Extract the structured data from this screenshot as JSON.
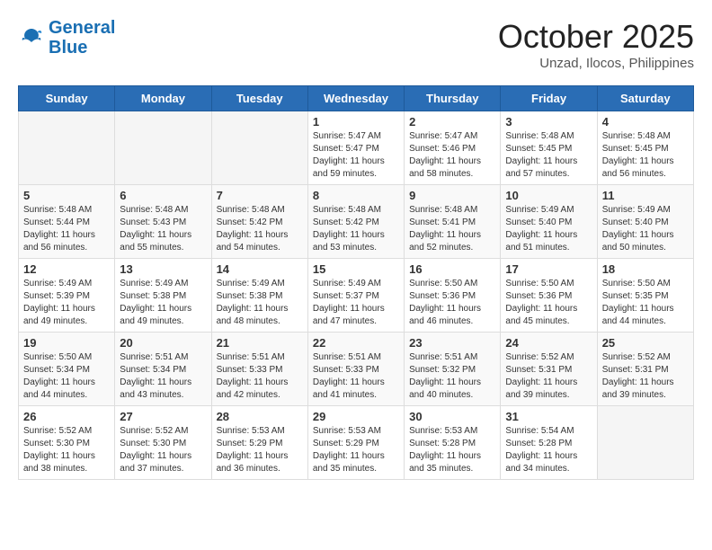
{
  "header": {
    "logo_line1": "General",
    "logo_line2": "Blue",
    "month_title": "October 2025",
    "location": "Unzad, Ilocos, Philippines"
  },
  "weekdays": [
    "Sunday",
    "Monday",
    "Tuesday",
    "Wednesday",
    "Thursday",
    "Friday",
    "Saturday"
  ],
  "weeks": [
    [
      {
        "day": "",
        "info": ""
      },
      {
        "day": "",
        "info": ""
      },
      {
        "day": "",
        "info": ""
      },
      {
        "day": "1",
        "info": "Sunrise: 5:47 AM\nSunset: 5:47 PM\nDaylight: 11 hours and 59 minutes."
      },
      {
        "day": "2",
        "info": "Sunrise: 5:47 AM\nSunset: 5:46 PM\nDaylight: 11 hours and 58 minutes."
      },
      {
        "day": "3",
        "info": "Sunrise: 5:48 AM\nSunset: 5:45 PM\nDaylight: 11 hours and 57 minutes."
      },
      {
        "day": "4",
        "info": "Sunrise: 5:48 AM\nSunset: 5:45 PM\nDaylight: 11 hours and 56 minutes."
      }
    ],
    [
      {
        "day": "5",
        "info": "Sunrise: 5:48 AM\nSunset: 5:44 PM\nDaylight: 11 hours and 56 minutes."
      },
      {
        "day": "6",
        "info": "Sunrise: 5:48 AM\nSunset: 5:43 PM\nDaylight: 11 hours and 55 minutes."
      },
      {
        "day": "7",
        "info": "Sunrise: 5:48 AM\nSunset: 5:42 PM\nDaylight: 11 hours and 54 minutes."
      },
      {
        "day": "8",
        "info": "Sunrise: 5:48 AM\nSunset: 5:42 PM\nDaylight: 11 hours and 53 minutes."
      },
      {
        "day": "9",
        "info": "Sunrise: 5:48 AM\nSunset: 5:41 PM\nDaylight: 11 hours and 52 minutes."
      },
      {
        "day": "10",
        "info": "Sunrise: 5:49 AM\nSunset: 5:40 PM\nDaylight: 11 hours and 51 minutes."
      },
      {
        "day": "11",
        "info": "Sunrise: 5:49 AM\nSunset: 5:40 PM\nDaylight: 11 hours and 50 minutes."
      }
    ],
    [
      {
        "day": "12",
        "info": "Sunrise: 5:49 AM\nSunset: 5:39 PM\nDaylight: 11 hours and 49 minutes."
      },
      {
        "day": "13",
        "info": "Sunrise: 5:49 AM\nSunset: 5:38 PM\nDaylight: 11 hours and 49 minutes."
      },
      {
        "day": "14",
        "info": "Sunrise: 5:49 AM\nSunset: 5:38 PM\nDaylight: 11 hours and 48 minutes."
      },
      {
        "day": "15",
        "info": "Sunrise: 5:49 AM\nSunset: 5:37 PM\nDaylight: 11 hours and 47 minutes."
      },
      {
        "day": "16",
        "info": "Sunrise: 5:50 AM\nSunset: 5:36 PM\nDaylight: 11 hours and 46 minutes."
      },
      {
        "day": "17",
        "info": "Sunrise: 5:50 AM\nSunset: 5:36 PM\nDaylight: 11 hours and 45 minutes."
      },
      {
        "day": "18",
        "info": "Sunrise: 5:50 AM\nSunset: 5:35 PM\nDaylight: 11 hours and 44 minutes."
      }
    ],
    [
      {
        "day": "19",
        "info": "Sunrise: 5:50 AM\nSunset: 5:34 PM\nDaylight: 11 hours and 44 minutes."
      },
      {
        "day": "20",
        "info": "Sunrise: 5:51 AM\nSunset: 5:34 PM\nDaylight: 11 hours and 43 minutes."
      },
      {
        "day": "21",
        "info": "Sunrise: 5:51 AM\nSunset: 5:33 PM\nDaylight: 11 hours and 42 minutes."
      },
      {
        "day": "22",
        "info": "Sunrise: 5:51 AM\nSunset: 5:33 PM\nDaylight: 11 hours and 41 minutes."
      },
      {
        "day": "23",
        "info": "Sunrise: 5:51 AM\nSunset: 5:32 PM\nDaylight: 11 hours and 40 minutes."
      },
      {
        "day": "24",
        "info": "Sunrise: 5:52 AM\nSunset: 5:31 PM\nDaylight: 11 hours and 39 minutes."
      },
      {
        "day": "25",
        "info": "Sunrise: 5:52 AM\nSunset: 5:31 PM\nDaylight: 11 hours and 39 minutes."
      }
    ],
    [
      {
        "day": "26",
        "info": "Sunrise: 5:52 AM\nSunset: 5:30 PM\nDaylight: 11 hours and 38 minutes."
      },
      {
        "day": "27",
        "info": "Sunrise: 5:52 AM\nSunset: 5:30 PM\nDaylight: 11 hours and 37 minutes."
      },
      {
        "day": "28",
        "info": "Sunrise: 5:53 AM\nSunset: 5:29 PM\nDaylight: 11 hours and 36 minutes."
      },
      {
        "day": "29",
        "info": "Sunrise: 5:53 AM\nSunset: 5:29 PM\nDaylight: 11 hours and 35 minutes."
      },
      {
        "day": "30",
        "info": "Sunrise: 5:53 AM\nSunset: 5:28 PM\nDaylight: 11 hours and 35 minutes."
      },
      {
        "day": "31",
        "info": "Sunrise: 5:54 AM\nSunset: 5:28 PM\nDaylight: 11 hours and 34 minutes."
      },
      {
        "day": "",
        "info": ""
      }
    ]
  ]
}
